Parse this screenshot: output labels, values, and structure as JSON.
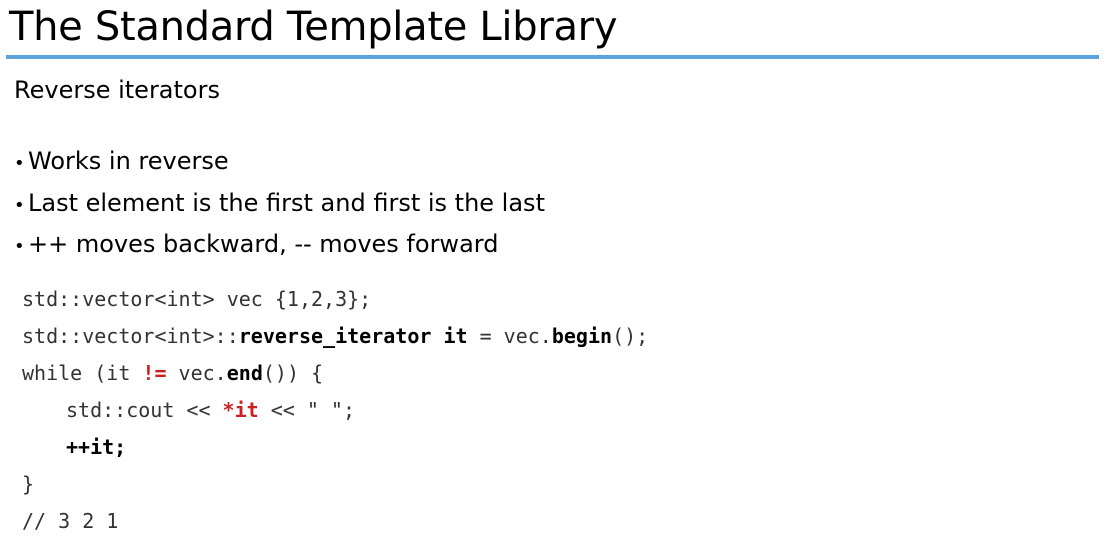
{
  "slide": {
    "title": "The Standard Template Library",
    "subtitle": "Reverse iterators",
    "accent_color": "#5ba3dd",
    "bullets": [
      "Works in reverse",
      "Last element is the first and first is the last",
      "++ moves backward, -- moves forward"
    ],
    "bullet_glyph": "•"
  },
  "code": {
    "line1": "std::vector<int> vec {1,2,3};",
    "line2": {
      "part1": "std::vector<int>::",
      "part2": "reverse_iterator",
      "part3": " ",
      "part4": "it",
      "part5": " = vec.",
      "part6": "begin",
      "part7": "();"
    },
    "line3": {
      "part1": "while (it ",
      "part2": "!=",
      "part3": " vec.",
      "part4": "end",
      "part5": "()) {"
    },
    "line4": {
      "part1": "std::cout << ",
      "part2": "*it",
      "part3": " << \" \";"
    },
    "line5": "++it;",
    "line6": "}",
    "line7": "// 3 2 1",
    "highlight_color": "#cc1f1f"
  }
}
